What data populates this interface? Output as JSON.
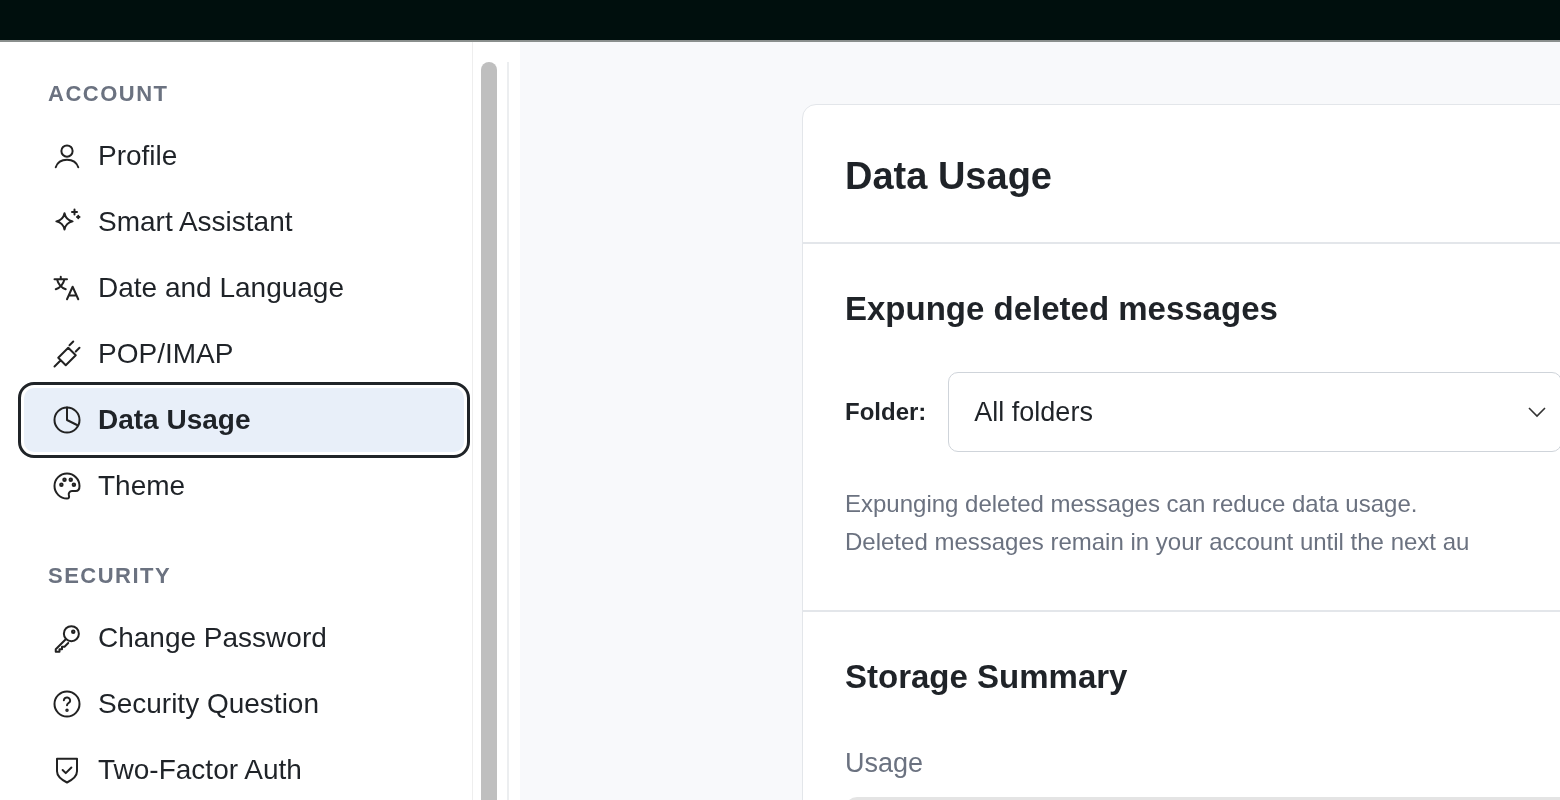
{
  "sidebar": {
    "sections": [
      {
        "title": "ACCOUNT",
        "items": [
          {
            "label": "Profile",
            "kind": "person",
            "selected": false
          },
          {
            "label": "Smart Assistant",
            "kind": "sparkle",
            "selected": false
          },
          {
            "label": "Date and Language",
            "kind": "translate",
            "selected": false
          },
          {
            "label": "POP/IMAP",
            "kind": "plug",
            "selected": false
          },
          {
            "label": "Data Usage",
            "kind": "pie",
            "selected": true
          },
          {
            "label": "Theme",
            "kind": "palette",
            "selected": false
          }
        ]
      },
      {
        "title": "SECURITY",
        "items": [
          {
            "label": "Change Password",
            "kind": "key",
            "selected": false
          },
          {
            "label": "Security Question",
            "kind": "question",
            "selected": false
          },
          {
            "label": "Two-Factor Auth",
            "kind": "shield",
            "selected": false
          }
        ]
      }
    ]
  },
  "card": {
    "title": "Data Usage",
    "expunge": {
      "title": "Expunge deleted messages",
      "folder_label": "Folder:",
      "folder_value": "All folders",
      "help": [
        "Expunging deleted messages can reduce data usage.",
        "Deleted messages remain in your account until the next au"
      ]
    },
    "storage": {
      "title": "Storage Summary",
      "usage_label": "Usage"
    }
  }
}
